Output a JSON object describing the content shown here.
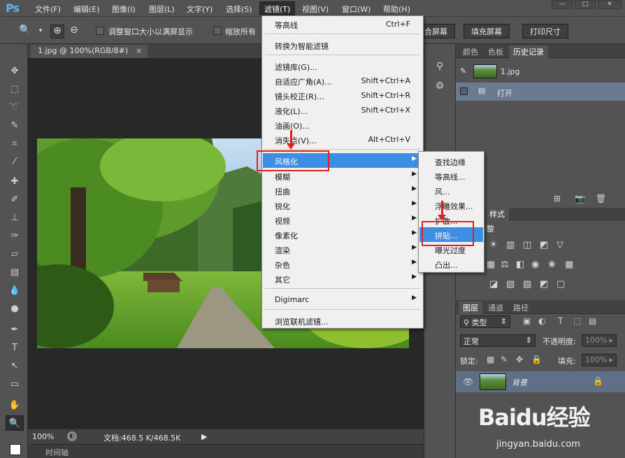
{
  "menubar": {
    "logo": "Ps",
    "items": [
      "文件(F)",
      "编辑(E)",
      "图像(I)",
      "图层(L)",
      "文字(Y)",
      "选择(S)",
      "滤镜(T)",
      "视图(V)",
      "窗口(W)",
      "帮助(H)"
    ],
    "active_index": 6
  },
  "options": {
    "resize_windows_label": "调整窗口大小以满屏显示",
    "zoom_all_label": "缩放所有",
    "btn_fill_screen_partial": "合屏幕",
    "btn_fill_screen": "填充屏幕",
    "btn_print_size": "打印尺寸"
  },
  "document": {
    "tab_title": "1.jpg @ 100%(RGB/8#)",
    "close_glyph": "×",
    "zoom": "100%",
    "doc_info": "文档:468.5 K/468.5K",
    "timeline_label": "时间轴"
  },
  "filter_menu": {
    "items": [
      {
        "label": "等高线",
        "shortcut": "Ctrl+F"
      },
      {
        "label": "转换为智能滤镜",
        "shortcut": ""
      },
      {
        "label": "滤镜库(G)...",
        "shortcut": ""
      },
      {
        "label": "自适应广角(A)...",
        "shortcut": "Shift+Ctrl+A"
      },
      {
        "label": "镜头校正(R)...",
        "shortcut": "Shift+Ctrl+R"
      },
      {
        "label": "液化(L)...",
        "shortcut": "Shift+Ctrl+X"
      },
      {
        "label": "油画(O)...",
        "shortcut": ""
      },
      {
        "label": "消失点(V)...",
        "shortcut": "Alt+Ctrl+V"
      },
      {
        "label": "风格化",
        "shortcut": ""
      },
      {
        "label": "模糊",
        "shortcut": ""
      },
      {
        "label": "扭曲",
        "shortcut": ""
      },
      {
        "label": "锐化",
        "shortcut": ""
      },
      {
        "label": "视频",
        "shortcut": ""
      },
      {
        "label": "像素化",
        "shortcut": ""
      },
      {
        "label": "渲染",
        "shortcut": ""
      },
      {
        "label": "杂色",
        "shortcut": ""
      },
      {
        "label": "其它",
        "shortcut": ""
      },
      {
        "label": "Digimarc",
        "shortcut": ""
      },
      {
        "label": "浏览联机滤镜...",
        "shortcut": ""
      }
    ]
  },
  "stylize_submenu": {
    "items": [
      "查找边缘",
      "等高线...",
      "风...",
      "浮雕效果...",
      "扩散...",
      "拼贴...",
      "曝光过度",
      "凸出..."
    ],
    "highlighted_index": 5
  },
  "history_panel": {
    "tabs": [
      "颜色",
      "色板",
      "历史记录"
    ],
    "active_tab": 2,
    "snapshot_label": "1.jpg",
    "steps": [
      "打开"
    ]
  },
  "adjustments_panel": {
    "tab_partial": "样式",
    "title_partial": "整"
  },
  "layers_panel": {
    "tabs": [
      "图层",
      "通道",
      "路径"
    ],
    "filter_kind": "类型",
    "blend_mode": "正常",
    "opacity_label": "不透明度:",
    "opacity_value": "100%",
    "lock_label": "锁定:",
    "fill_label": "填充:",
    "fill_value": "100%",
    "layer_name": "背景"
  },
  "watermark": {
    "main": "Baidu经验",
    "sub": "jingyan.baidu.com"
  },
  "colors": {
    "menu_highlight": "#3d8fe6",
    "annotation_red": "#e02020",
    "layer_selected": "#5f6f86"
  }
}
